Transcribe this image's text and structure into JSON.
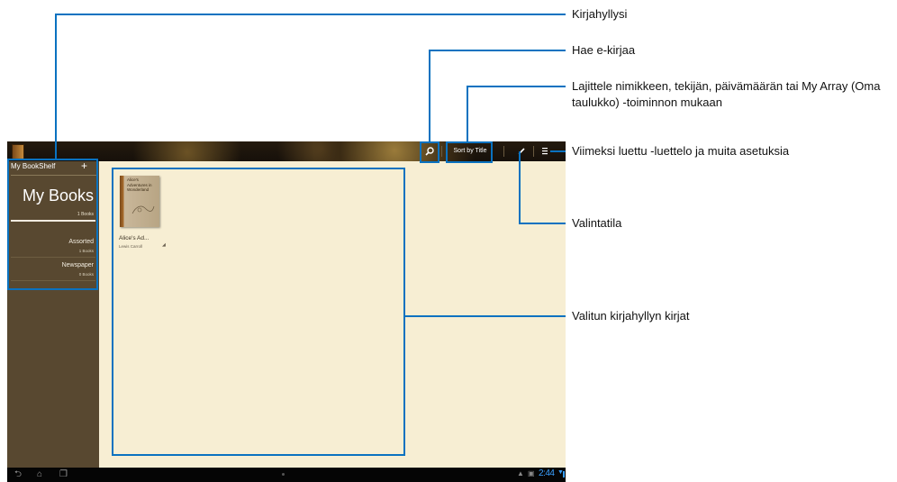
{
  "topbar": {
    "sort_label": "Sort by Title",
    "search_icon": "search-icon",
    "selection_icon": "pencil-icon",
    "menu_icon": "menu-icon"
  },
  "sidebar": {
    "title": "My BookShelf",
    "add_icon": "plus-icon",
    "my_books": {
      "label": "My Books",
      "count": "1 Books"
    },
    "items": [
      {
        "label": "Assorted",
        "count": "1 Books"
      },
      {
        "label": "Newspaper",
        "count": "0 Books"
      }
    ]
  },
  "books": [
    {
      "cover_title": "Alice's Adventures in Wonderland",
      "title": "Alice's Ad...",
      "author": "Lewis Carroll"
    }
  ],
  "statusbar": {
    "time": "2:44"
  },
  "callouts": [
    {
      "id": "bookshelf",
      "text": "Kirjahyllysi"
    },
    {
      "id": "search",
      "text": "Hae e-kirjaa"
    },
    {
      "id": "sort",
      "text": "Lajittele nimikkeen, tekijän, päivämäärän tai My Array (Oma taulukko) -toiminnon mukaan"
    },
    {
      "id": "menu",
      "text": "Viimeksi luettu -luettelo ja muita asetuksia"
    },
    {
      "id": "selection",
      "text": "Valintatila"
    },
    {
      "id": "books",
      "text": "Valitun kirjahyllyn kirjat"
    }
  ],
  "colors": {
    "callout": "#0a72c0",
    "book_area": "#f7eed3",
    "sidebar": "#584830"
  }
}
